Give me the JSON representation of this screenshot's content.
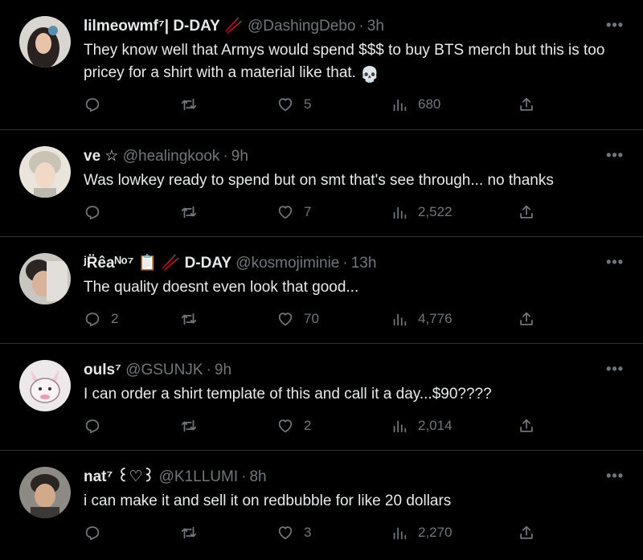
{
  "tweets": [
    {
      "name": "lilmeowmf⁷| D-DAY",
      "name_suffix": "🥢",
      "handle": "@DashingDebo",
      "time": "3h",
      "text": "They know well that Armys would spend $$$ to buy BTS merch but this is too pricey for a shirt with a material like that.",
      "text_emoji": "💀",
      "replies": "",
      "retweets": "",
      "likes": "5",
      "views": "680"
    },
    {
      "name": "ve ☆",
      "name_suffix": "",
      "handle": "@healingkook",
      "time": "9h",
      "text": "Was lowkey ready to spend but on smt that's see through... no thanks",
      "text_emoji": "",
      "replies": "",
      "retweets": "",
      "likes": "7",
      "views": "2,522"
    },
    {
      "name": "ʲR̈êaᴺᵒ⁷",
      "name_suffix": "📋 🥢 D-DAY",
      "handle": "@kosmojiminie",
      "time": "13h",
      "text": "The quality doesnt even look that good...",
      "text_emoji": "",
      "replies": "2",
      "retweets": "",
      "likes": "70",
      "views": "4,776"
    },
    {
      "name": "ouls⁷",
      "name_suffix": "",
      "handle": "@GSUNJK",
      "time": "9h",
      "text": "I can order a shirt template of this and call it a day...$90????",
      "text_emoji": "",
      "replies": "",
      "retweets": "",
      "likes": "2",
      "views": "2,014"
    },
    {
      "name": "nat⁷ ꒰♡꒱",
      "name_suffix": "",
      "handle": "@K1LLUMI",
      "time": "8h",
      "text": "i can make it and sell it on redbubble for like 20 dollars",
      "text_emoji": "",
      "replies": "",
      "retweets": "",
      "likes": "3",
      "views": "2,270"
    }
  ],
  "ui": {
    "more_label": "•••",
    "dot": "·"
  },
  "colors": {
    "background": "#000000",
    "text": "#e7e9ea",
    "muted": "#71767b",
    "divider": "#2f3336"
  }
}
